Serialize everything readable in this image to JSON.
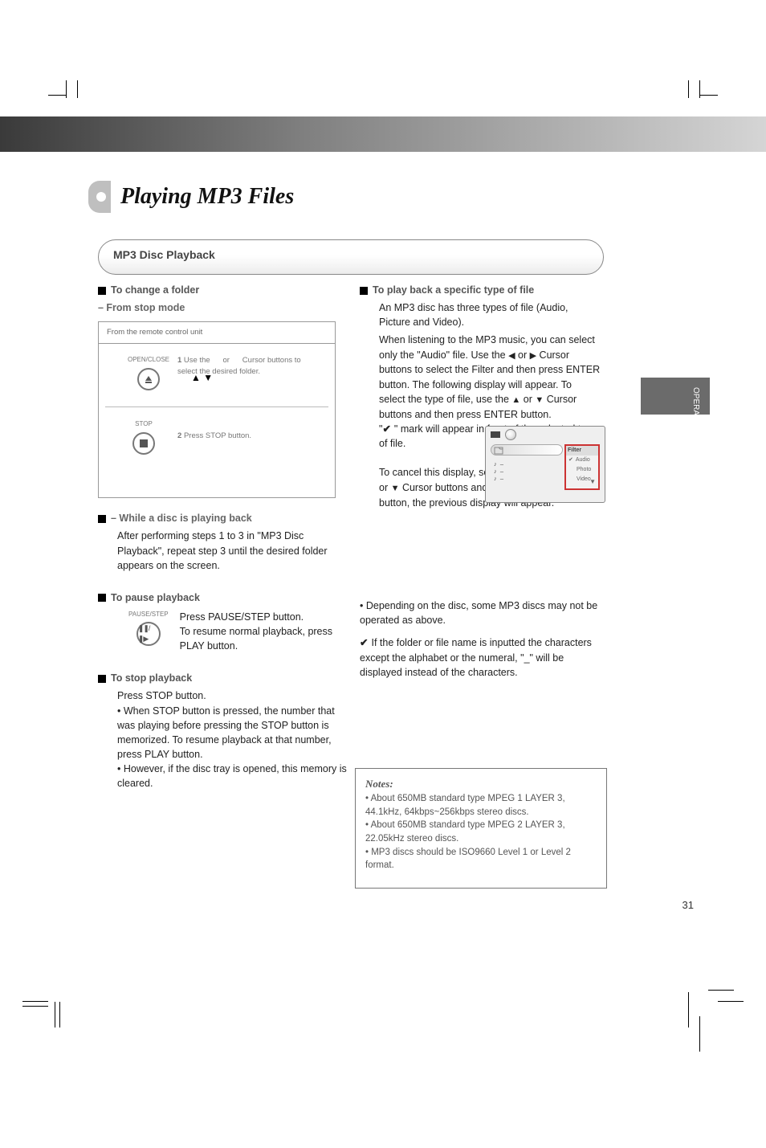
{
  "title": "Playing MP3 Files",
  "pill_header": "MP3 Disc Playback",
  "page_number": "31",
  "side_tab": "OPERATION",
  "left": {
    "heading1": "To change a folder",
    "sub1": "– From stop mode",
    "remote_header": "From the remote control unit",
    "rc_open_close_label": "OPEN/CLOSE",
    "rc_stop_label": "STOP",
    "rc_arrows_text": "Use the     or     Cursor buttons to select the desired folder.",
    "rc_stop_text": "Press STOP button.",
    "sub2": "– While a disc is playing back",
    "sub2_text": "After performing steps 1 to 3 in \"MP3 Disc Playback\", repeat step 3 until the desired folder appears on the screen.",
    "heading2": "To pause playback",
    "rc_pause_label": "PAUSE/STEP",
    "pause_body": "Press PAUSE/STEP button.\nTo resume normal playback, press PLAY button.",
    "heading3": "To stop playback",
    "stop_body": "Press STOP button.\n• When STOP button is pressed, the number that was playing before pressing the STOP button is memorized. To resume playback at that number, press PLAY button.\n• However, if the disc tray is opened, this memory is cleared."
  },
  "right": {
    "heading1": "To play back a specific type of file",
    "p1": "An MP3 disc has three types of file (Audio, Picture and Video).",
    "p2_a": "When listening to the MP3 music, you can select only the \"Audio\" file. Use the     or     Cursor buttons to select the Filter and then press ENTER button. The following display will appear. To select the type of file, use the     or     Cursor buttons and then press ENTER button.",
    "p2_b": "\"✔\" mark will appear in front of the selected type of file.",
    "p2_c": "To cancel this display, select \"– – – –\" using the     or     Cursor buttons and then press ENTER button, the previous display will appear.",
    "filter_label": "Filter",
    "filter_audio": "Audio",
    "filter_photo": "Photo",
    "filter_video": "Video",
    "li1": "Depending on the disc, some MP3 discs may not be operated as above.",
    "li2": "✔ If the folder or file name is inputted the characters except the alphabet or the numeral, \"_\" will be displayed instead of the characters.",
    "notes_title": "Notes:",
    "note1": "• About 650MB standard type MPEG 1 LAYER 3, 44.1kHz, 64kbps~256kbps stereo discs.",
    "note2": "• About 650MB standard type MPEG 2 LAYER 3, 22.05kHz stereo discs.",
    "note3": "• MP3 discs should be ISO9660 Level 1 or Level 2 format."
  }
}
